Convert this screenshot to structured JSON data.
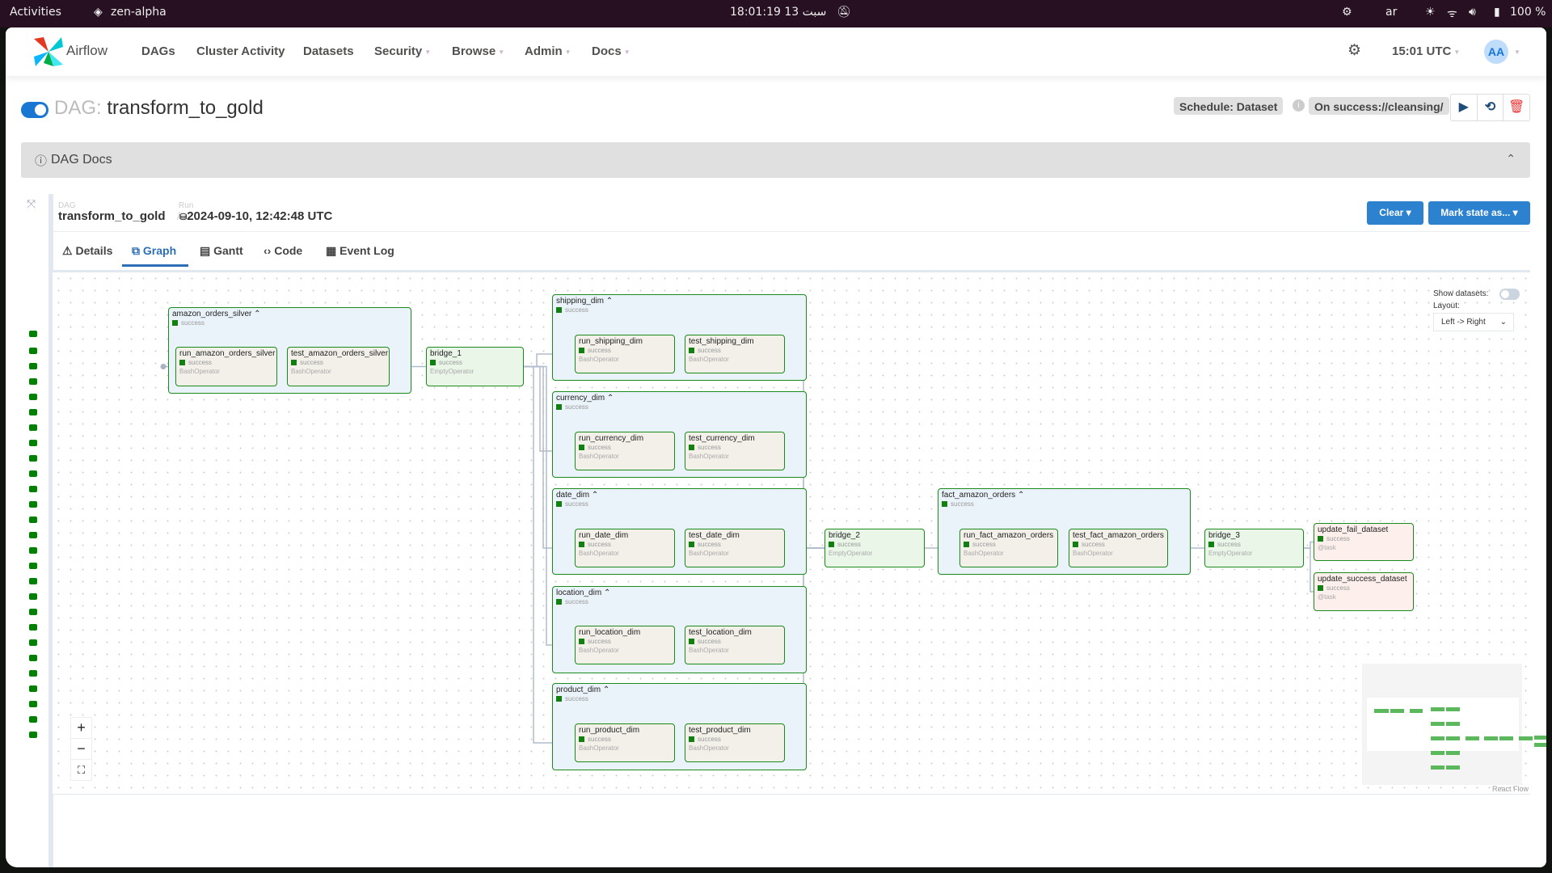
{
  "system_bar": {
    "activities": "Activities",
    "workspace": "zen-alpha",
    "clock": "18:01:19  13 سبت",
    "lang": "ar",
    "battery": "100 %"
  },
  "nav": {
    "brand": "Airflow",
    "items": [
      {
        "label": "DAGs"
      },
      {
        "label": "Cluster Activity"
      },
      {
        "label": "Datasets"
      },
      {
        "label": "Security"
      },
      {
        "label": "Browse"
      },
      {
        "label": "Admin"
      },
      {
        "label": "Docs"
      }
    ],
    "time": "15:01 UTC",
    "avatar": "AA"
  },
  "dag": {
    "prefix": "DAG:",
    "name": "transform_to_gold",
    "paused": false,
    "schedule": "Schedule: Dataset",
    "on_success": "On success://cleansing/",
    "docs_label": "DAG Docs"
  },
  "run_header": {
    "dag_label": "DAG",
    "dag_name": "transform_to_gold",
    "run_label": "Run",
    "run_id": "2024-09-10, 12:42:48 UTC",
    "clear": "Clear",
    "mark_state": "Mark state as..."
  },
  "tabs": [
    {
      "label": "Details",
      "active": false
    },
    {
      "label": "Graph",
      "active": true
    },
    {
      "label": "Gantt",
      "active": false
    },
    {
      "label": "Code",
      "active": false
    },
    {
      "label": "Event Log",
      "active": false
    }
  ],
  "graph_controls": {
    "show_datasets": "Show datasets:",
    "show_datasets_on": false,
    "layout_label": "Layout:",
    "layout_value": "Left -> Right",
    "attribution": "React Flow"
  },
  "status_colors": {
    "success": "#008000"
  },
  "groups": [
    {
      "id": "amazon_orders_silver",
      "status": "success",
      "children": [
        {
          "id": "run_amazon_orders_silver",
          "status": "success",
          "operator": "BashOperator"
        },
        {
          "id": "test_amazon_orders_silver",
          "status": "success",
          "operator": "BashOperator"
        }
      ]
    },
    {
      "id": "shipping_dim",
      "status": "success",
      "children": [
        {
          "id": "run_shipping_dim",
          "status": "success",
          "operator": "BashOperator"
        },
        {
          "id": "test_shipping_dim",
          "status": "success",
          "operator": "BashOperator"
        }
      ]
    },
    {
      "id": "currency_dim",
      "status": "success",
      "children": [
        {
          "id": "run_currency_dim",
          "status": "success",
          "operator": "BashOperator"
        },
        {
          "id": "test_currency_dim",
          "status": "success",
          "operator": "BashOperator"
        }
      ]
    },
    {
      "id": "date_dim",
      "status": "success",
      "children": [
        {
          "id": "run_date_dim",
          "status": "success",
          "operator": "BashOperator"
        },
        {
          "id": "test_date_dim",
          "status": "success",
          "operator": "BashOperator"
        }
      ]
    },
    {
      "id": "location_dim",
      "status": "success",
      "children": [
        {
          "id": "run_location_dim",
          "status": "success",
          "operator": "BashOperator"
        },
        {
          "id": "test_location_dim",
          "status": "success",
          "operator": "BashOperator"
        }
      ]
    },
    {
      "id": "product_dim",
      "status": "success",
      "children": [
        {
          "id": "run_product_dim",
          "status": "success",
          "operator": "BashOperator"
        },
        {
          "id": "test_product_dim",
          "status": "success",
          "operator": "BashOperator"
        }
      ]
    },
    {
      "id": "fact_amazon_orders",
      "status": "success",
      "children": [
        {
          "id": "run_fact_amazon_orders",
          "status": "success",
          "operator": "BashOperator"
        },
        {
          "id": "test_fact_amazon_orders",
          "status": "success",
          "operator": "BashOperator"
        }
      ]
    }
  ],
  "tasks": [
    {
      "id": "bridge_1",
      "status": "success",
      "operator": "EmptyOperator"
    },
    {
      "id": "bridge_2",
      "status": "success",
      "operator": "EmptyOperator"
    },
    {
      "id": "bridge_3",
      "status": "success",
      "operator": "EmptyOperator"
    },
    {
      "id": "update_fail_dataset",
      "status": "success",
      "operator": "@task"
    },
    {
      "id": "update_success_dataset",
      "status": "success",
      "operator": "@task"
    }
  ],
  "edges": [
    [
      "amazon_orders_silver",
      "bridge_1"
    ],
    [
      "bridge_1",
      "shipping_dim"
    ],
    [
      "bridge_1",
      "currency_dim"
    ],
    [
      "bridge_1",
      "date_dim"
    ],
    [
      "bridge_1",
      "location_dim"
    ],
    [
      "bridge_1",
      "product_dim"
    ],
    [
      "shipping_dim",
      "bridge_2"
    ],
    [
      "currency_dim",
      "bridge_2"
    ],
    [
      "date_dim",
      "bridge_2"
    ],
    [
      "location_dim",
      "bridge_2"
    ],
    [
      "product_dim",
      "bridge_2"
    ],
    [
      "bridge_2",
      "fact_amazon_orders"
    ],
    [
      "fact_amazon_orders",
      "bridge_3"
    ],
    [
      "bridge_3",
      "update_fail_dataset"
    ],
    [
      "bridge_3",
      "update_success_dataset"
    ]
  ],
  "grid_run_count": 27
}
